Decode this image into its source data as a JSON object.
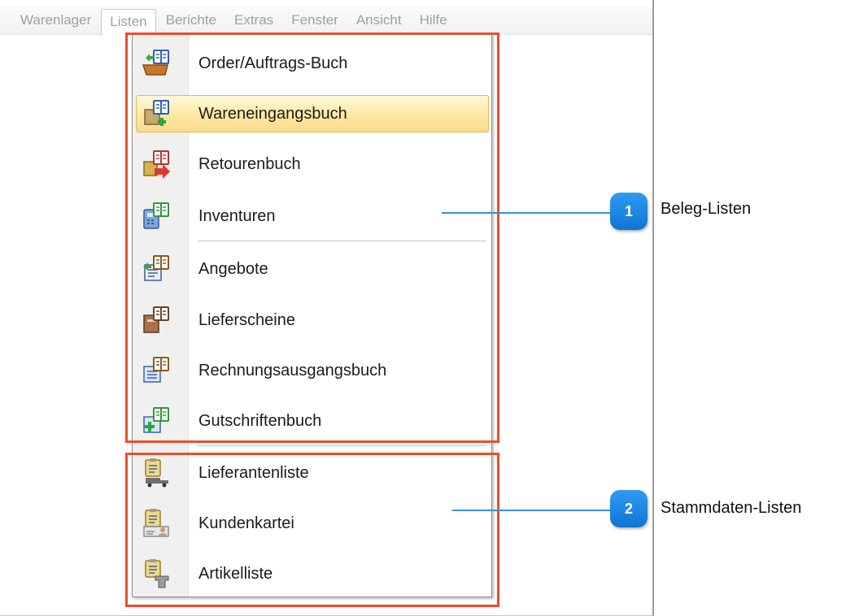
{
  "menubar": {
    "items": [
      {
        "label": "Warenlager"
      },
      {
        "label": "Listen"
      },
      {
        "label": "Berichte"
      },
      {
        "label": "Extras"
      },
      {
        "label": "Fenster"
      },
      {
        "label": "Ansicht"
      },
      {
        "label": "Hilfe"
      }
    ],
    "active": "Listen"
  },
  "dropdown": {
    "items": [
      {
        "label": "Order/Auftrags-Buch",
        "icon": "order-book-icon"
      },
      {
        "label": "Wareneingangsbuch",
        "icon": "goods-receipt-book-icon",
        "highlighted": true
      },
      {
        "label": "Retourenbuch",
        "icon": "returns-book-icon"
      },
      {
        "label": "Inventuren",
        "icon": "inventory-book-icon"
      },
      {
        "label": "Angebote",
        "icon": "offers-book-icon"
      },
      {
        "label": "Lieferscheine",
        "icon": "delivery-notes-book-icon"
      },
      {
        "label": "Rechnungsausgangsbuch",
        "icon": "invoice-book-icon"
      },
      {
        "label": "Gutschriftenbuch",
        "icon": "credit-notes-book-icon"
      },
      {
        "label": "Lieferantenliste",
        "icon": "supplier-list-icon"
      },
      {
        "label": "Kundenkartei",
        "icon": "customer-file-icon"
      },
      {
        "label": "Artikelliste",
        "icon": "article-list-icon"
      }
    ]
  },
  "callouts": [
    {
      "number": "1",
      "text": "Beleg-Listen"
    },
    {
      "number": "2",
      "text": "Stammdaten-Listen"
    }
  ],
  "colors": {
    "annotation_frame": "#ec4d2a",
    "callout_badge": "#1683e0",
    "highlight": "#fde7a3"
  }
}
